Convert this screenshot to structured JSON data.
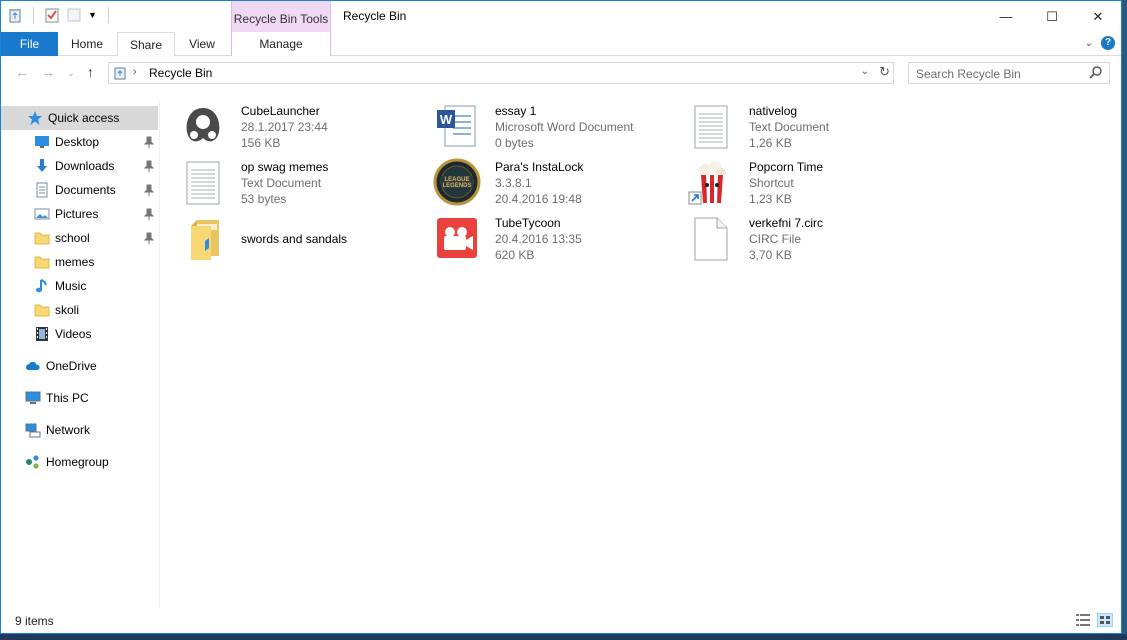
{
  "window": {
    "title": "Recycle Bin",
    "contextual_tab": "Recycle Bin Tools",
    "minimize": "—",
    "maximize": "☐",
    "close": "✕"
  },
  "ribbon": {
    "tabs": [
      "File",
      "Home",
      "Share",
      "View"
    ],
    "manage": "Manage",
    "help": "?"
  },
  "address": {
    "crumb": "Recycle Bin",
    "search_placeholder": "Search Recycle Bin"
  },
  "nav": {
    "quick_access": "Quick access",
    "pinned": [
      {
        "label": "Desktop",
        "icon": "desktop-icon"
      },
      {
        "label": "Downloads",
        "icon": "downloads-icon"
      },
      {
        "label": "Documents",
        "icon": "documents-icon"
      },
      {
        "label": "Pictures",
        "icon": "pictures-icon"
      },
      {
        "label": "school",
        "icon": "folder-icon"
      }
    ],
    "folders": [
      {
        "label": "memes",
        "icon": "folder-icon"
      },
      {
        "label": "Music",
        "icon": "music-icon"
      },
      {
        "label": "skoli",
        "icon": "folder-icon"
      },
      {
        "label": "Videos",
        "icon": "videos-icon"
      }
    ],
    "roots": [
      "OneDrive",
      "This PC",
      "Network",
      "Homegroup"
    ]
  },
  "items": [
    {
      "name": "CubeLauncher",
      "line2": "28.1.2017 23:44",
      "line3": "156 KB",
      "icon": "cubelauncher-icon"
    },
    {
      "name": "essay 1",
      "line2": "Microsoft Word Document",
      "line3": "0 bytes",
      "icon": "word-document-icon"
    },
    {
      "name": "nativelog",
      "line2": "Text Document",
      "line3": "1,26 KB",
      "icon": "text-document-icon"
    },
    {
      "name": "op swag memes",
      "line2": "Text Document",
      "line3": "53 bytes",
      "icon": "text-document-icon"
    },
    {
      "name": "Para's InstaLock",
      "line2": "3.3.8.1",
      "line3": "20.4.2016 19:48",
      "icon": "league-of-legends-icon"
    },
    {
      "name": "Popcorn Time",
      "line2": "Shortcut",
      "line3": "1,23 KB",
      "icon": "popcorn-time-icon"
    },
    {
      "name": "swords and sandals",
      "line2": "",
      "line3": "",
      "icon": "folder-icon"
    },
    {
      "name": "TubeTycoon",
      "line2": "20.4.2016 13:35",
      "line3": "620 KB",
      "icon": "tubetycoon-icon"
    },
    {
      "name": "verkefni 7.circ",
      "line2": "CIRC File",
      "line3": "3,70 KB",
      "icon": "blank-file-icon"
    }
  ],
  "status": {
    "count": "9 items"
  },
  "colors": {
    "accent": "#1979ca",
    "contextual": "#f1d8f5",
    "selection": "#d9d9d9"
  }
}
